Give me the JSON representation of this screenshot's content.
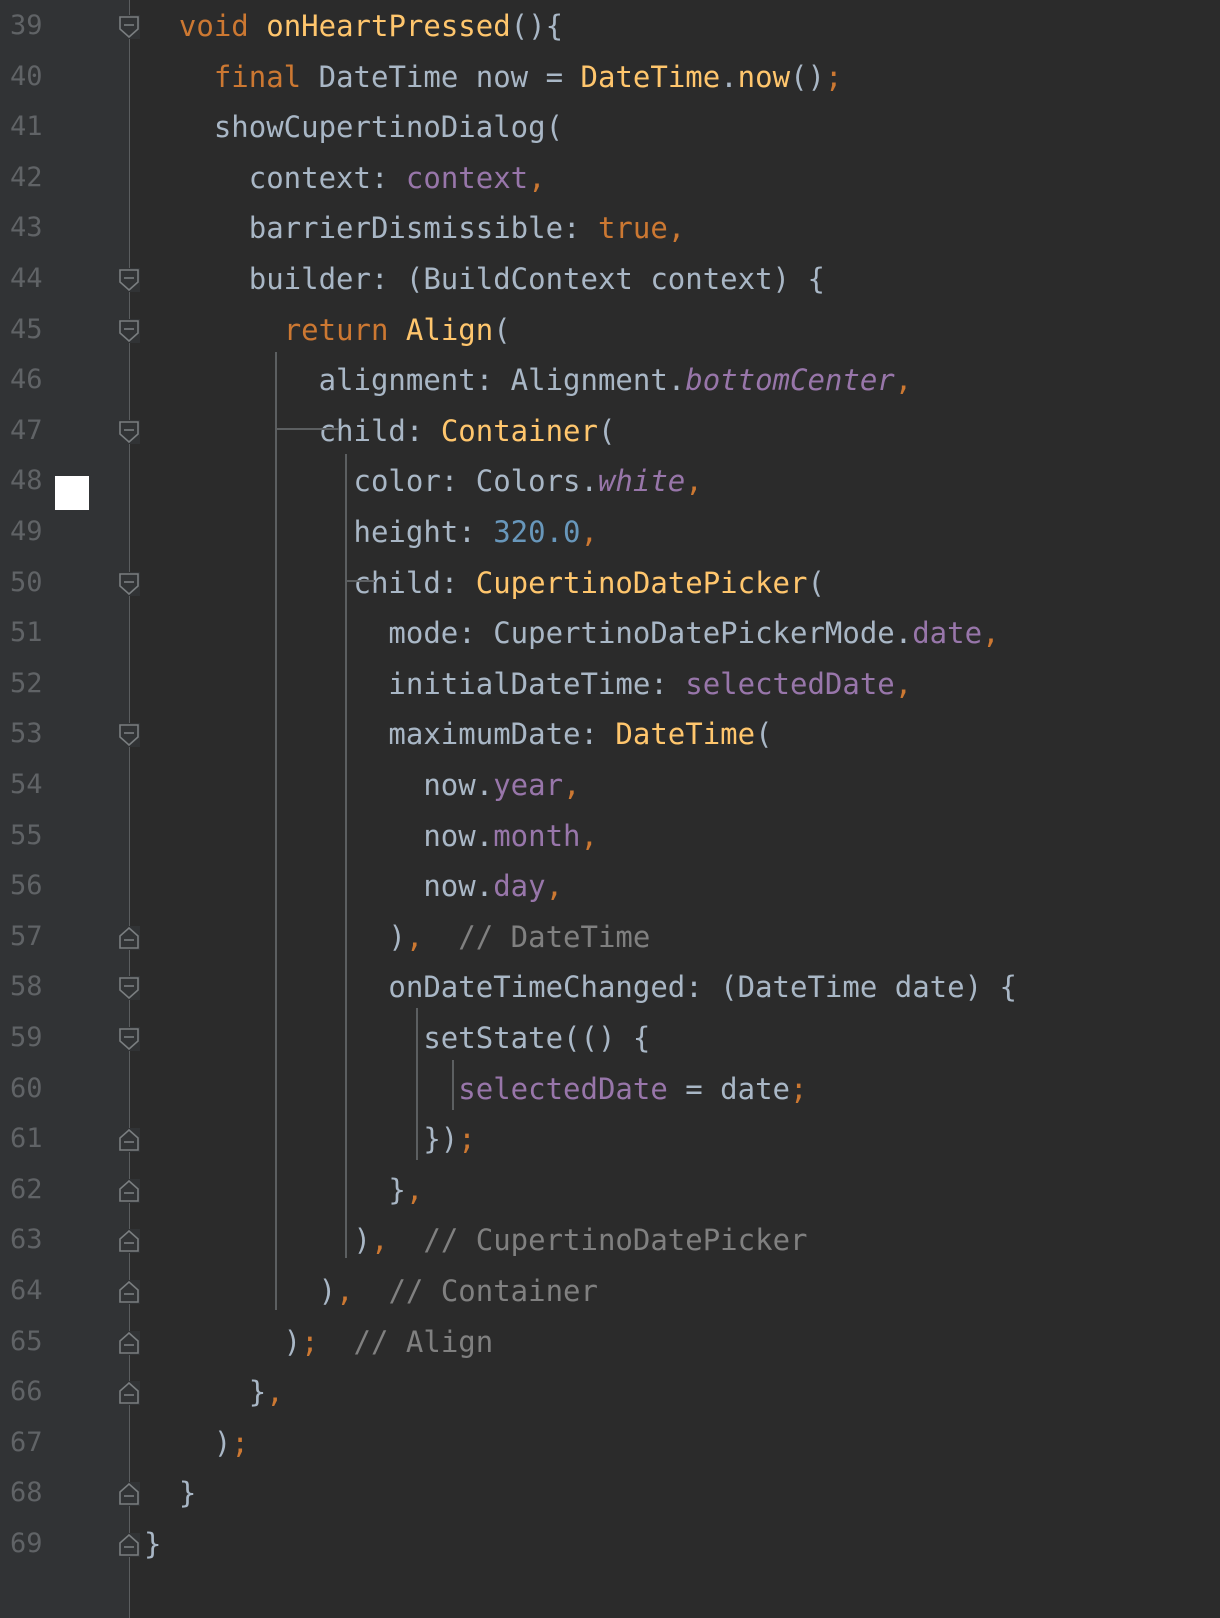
{
  "editor": {
    "language": "dart",
    "theme_colors": {
      "background": "#2b2b2b",
      "gutter": "#313335",
      "line_number": "#606366",
      "plain": "#a9b7c6",
      "keyword": "#cc7832",
      "function": "#ffc66d",
      "field": "#9876aa",
      "number": "#6897bb",
      "comment": "#808080"
    },
    "bookmark_line": "48",
    "lines": [
      {
        "num": "39",
        "fold": "open",
        "tokens": [
          {
            "t": "  ",
            "c": "plain"
          },
          {
            "t": "void",
            "c": "keyword"
          },
          {
            "t": " ",
            "c": "plain"
          },
          {
            "t": "onHeartPressed",
            "c": "fn"
          },
          {
            "t": "(){",
            "c": "plain"
          }
        ]
      },
      {
        "num": "40",
        "fold": "",
        "tokens": [
          {
            "t": "    ",
            "c": "plain"
          },
          {
            "t": "final",
            "c": "keyword"
          },
          {
            "t": " DateTime now = ",
            "c": "plain"
          },
          {
            "t": "DateTime",
            "c": "fn"
          },
          {
            "t": ".",
            "c": "plain"
          },
          {
            "t": "now",
            "c": "fn"
          },
          {
            "t": "()",
            "c": "plain"
          },
          {
            "t": ";",
            "c": "punct"
          }
        ]
      },
      {
        "num": "41",
        "fold": "",
        "tokens": [
          {
            "t": "    showCupertinoDialog(",
            "c": "plain"
          }
        ]
      },
      {
        "num": "42",
        "fold": "",
        "tokens": [
          {
            "t": "      context: ",
            "c": "plain"
          },
          {
            "t": "context",
            "c": "field"
          },
          {
            "t": ",",
            "c": "punct"
          }
        ]
      },
      {
        "num": "43",
        "fold": "",
        "tokens": [
          {
            "t": "      barrierDismissible: ",
            "c": "plain"
          },
          {
            "t": "true",
            "c": "keyword"
          },
          {
            "t": ",",
            "c": "punct"
          }
        ]
      },
      {
        "num": "44",
        "fold": "open",
        "tokens": [
          {
            "t": "      builder: (BuildContext context) {",
            "c": "plain"
          }
        ]
      },
      {
        "num": "45",
        "fold": "open",
        "tokens": [
          {
            "t": "        ",
            "c": "plain"
          },
          {
            "t": "return",
            "c": "keyword"
          },
          {
            "t": " ",
            "c": "plain"
          },
          {
            "t": "Align",
            "c": "fn"
          },
          {
            "t": "(",
            "c": "plain"
          }
        ]
      },
      {
        "num": "46",
        "fold": "",
        "tokens": [
          {
            "t": "          alignment: Alignment.",
            "c": "plain"
          },
          {
            "t": "bottomCenter",
            "c": "field-italic"
          },
          {
            "t": ",",
            "c": "punct"
          }
        ]
      },
      {
        "num": "47",
        "fold": "open",
        "tokens": [
          {
            "t": "          child: ",
            "c": "plain"
          },
          {
            "t": "Container",
            "c": "fn"
          },
          {
            "t": "(",
            "c": "plain"
          }
        ]
      },
      {
        "num": "48",
        "fold": "",
        "tokens": [
          {
            "t": "            color: Colors.",
            "c": "plain"
          },
          {
            "t": "white",
            "c": "field-italic"
          },
          {
            "t": ",",
            "c": "punct"
          }
        ]
      },
      {
        "num": "49",
        "fold": "",
        "tokens": [
          {
            "t": "            height: ",
            "c": "plain"
          },
          {
            "t": "320.0",
            "c": "number"
          },
          {
            "t": ",",
            "c": "punct"
          }
        ]
      },
      {
        "num": "50",
        "fold": "open",
        "tokens": [
          {
            "t": "            child: ",
            "c": "plain"
          },
          {
            "t": "CupertinoDatePicker",
            "c": "fn"
          },
          {
            "t": "(",
            "c": "plain"
          }
        ]
      },
      {
        "num": "51",
        "fold": "",
        "tokens": [
          {
            "t": "              mode: CupertinoDatePickerMode.",
            "c": "plain"
          },
          {
            "t": "date",
            "c": "field"
          },
          {
            "t": ",",
            "c": "punct"
          }
        ]
      },
      {
        "num": "52",
        "fold": "",
        "tokens": [
          {
            "t": "              initialDateTime: ",
            "c": "plain"
          },
          {
            "t": "selectedDate",
            "c": "field"
          },
          {
            "t": ",",
            "c": "punct"
          }
        ]
      },
      {
        "num": "53",
        "fold": "open",
        "tokens": [
          {
            "t": "              maximumDate: ",
            "c": "plain"
          },
          {
            "t": "DateTime",
            "c": "fn"
          },
          {
            "t": "(",
            "c": "plain"
          }
        ]
      },
      {
        "num": "54",
        "fold": "",
        "tokens": [
          {
            "t": "                now.",
            "c": "plain"
          },
          {
            "t": "year",
            "c": "field"
          },
          {
            "t": ",",
            "c": "punct"
          }
        ]
      },
      {
        "num": "55",
        "fold": "",
        "tokens": [
          {
            "t": "                now.",
            "c": "plain"
          },
          {
            "t": "month",
            "c": "field"
          },
          {
            "t": ",",
            "c": "punct"
          }
        ]
      },
      {
        "num": "56",
        "fold": "",
        "tokens": [
          {
            "t": "                now.",
            "c": "plain"
          },
          {
            "t": "day",
            "c": "field"
          },
          {
            "t": ",",
            "c": "punct"
          }
        ]
      },
      {
        "num": "57",
        "fold": "close",
        "tokens": [
          {
            "t": "              )",
            "c": "plain"
          },
          {
            "t": ",",
            "c": "punct"
          },
          {
            "t": "  ",
            "c": "plain"
          },
          {
            "t": "// DateTime",
            "c": "comment"
          }
        ]
      },
      {
        "num": "58",
        "fold": "open",
        "tokens": [
          {
            "t": "              onDateTimeChanged: (DateTime date) {",
            "c": "plain"
          }
        ]
      },
      {
        "num": "59",
        "fold": "open",
        "tokens": [
          {
            "t": "                setState(() {",
            "c": "plain"
          }
        ]
      },
      {
        "num": "60",
        "fold": "",
        "tokens": [
          {
            "t": "                  ",
            "c": "plain"
          },
          {
            "t": "selectedDate",
            "c": "field"
          },
          {
            "t": " = date",
            "c": "plain"
          },
          {
            "t": ";",
            "c": "punct"
          }
        ]
      },
      {
        "num": "61",
        "fold": "close",
        "tokens": [
          {
            "t": "                })",
            "c": "plain"
          },
          {
            "t": ";",
            "c": "punct"
          }
        ]
      },
      {
        "num": "62",
        "fold": "close",
        "tokens": [
          {
            "t": "              }",
            "c": "plain"
          },
          {
            "t": ",",
            "c": "punct"
          }
        ]
      },
      {
        "num": "63",
        "fold": "close",
        "tokens": [
          {
            "t": "            )",
            "c": "plain"
          },
          {
            "t": ",",
            "c": "punct"
          },
          {
            "t": "  ",
            "c": "plain"
          },
          {
            "t": "// CupertinoDatePicker",
            "c": "comment"
          }
        ]
      },
      {
        "num": "64",
        "fold": "close",
        "tokens": [
          {
            "t": "          )",
            "c": "plain"
          },
          {
            "t": ",",
            "c": "punct"
          },
          {
            "t": "  ",
            "c": "plain"
          },
          {
            "t": "// Container",
            "c": "comment"
          }
        ]
      },
      {
        "num": "65",
        "fold": "close",
        "tokens": [
          {
            "t": "        )",
            "c": "plain"
          },
          {
            "t": ";",
            "c": "punct"
          },
          {
            "t": "  ",
            "c": "plain"
          },
          {
            "t": "// Align",
            "c": "comment"
          }
        ]
      },
      {
        "num": "66",
        "fold": "close",
        "tokens": [
          {
            "t": "      }",
            "c": "plain"
          },
          {
            "t": ",",
            "c": "punct"
          }
        ]
      },
      {
        "num": "67",
        "fold": "",
        "tokens": [
          {
            "t": "    )",
            "c": "plain"
          },
          {
            "t": ";",
            "c": "punct"
          }
        ]
      },
      {
        "num": "68",
        "fold": "close",
        "tokens": [
          {
            "t": "  }",
            "c": "plain"
          }
        ]
      },
      {
        "num": "69",
        "fold": "close",
        "tokens": [
          {
            "t": "}",
            "c": "plain"
          }
        ]
      }
    ]
  }
}
